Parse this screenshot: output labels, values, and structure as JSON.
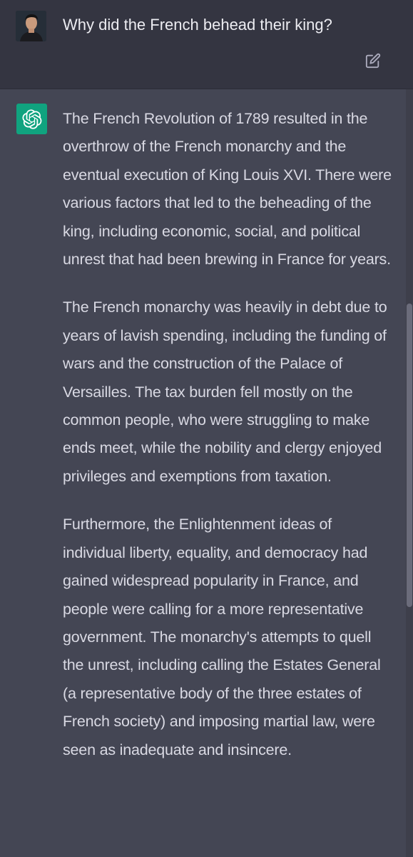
{
  "user_message": {
    "text": "Why did the French behead their king?",
    "avatar_icon": "user-photo-icon",
    "edit_icon": "edit-icon"
  },
  "assistant_message": {
    "avatar_icon": "openai-logo-icon",
    "paragraphs": [
      "The French Revolution of 1789 resulted in the overthrow of the French monarchy and the eventual execution of King Louis XVI. There were various factors that led to the beheading of the king, including economic, social, and political unrest that had been brewing in France for years.",
      "The French monarchy was heavily in debt due to years of lavish spending, including the funding of wars and the construction of the Palace of Versailles. The tax burden fell mostly on the common people, who were struggling to make ends meet, while the nobility and clergy enjoyed privileges and exemptions from taxation.",
      "Furthermore, the Enlightenment ideas of individual liberty, equality, and democracy had gained widespread popularity in France, and people were calling for a more representative government. The monarchy's attempts to quell the unrest, including calling the Estates General (a representative body of the three estates of French society) and imposing martial law, were seen as inadequate and insincere."
    ]
  },
  "colors": {
    "user_bg": "#343541",
    "assistant_bg": "#444654",
    "logo_bg": "#10a37f"
  }
}
